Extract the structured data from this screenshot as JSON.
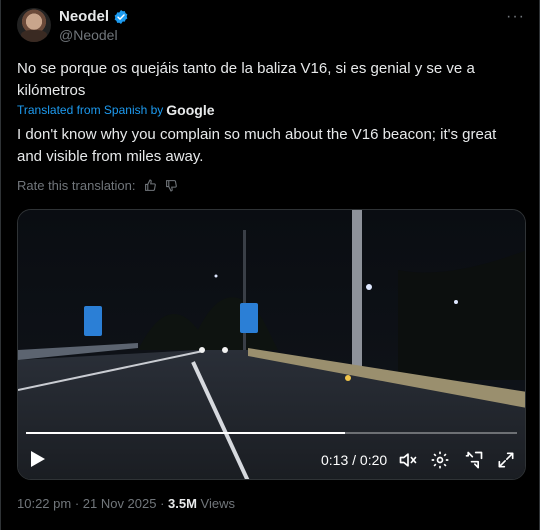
{
  "author": {
    "display_name": "Neodel",
    "handle": "@Neodel",
    "verified": true
  },
  "more_icon": "more-horizontal-icon",
  "tweet": {
    "text": "No se porque os quejáis tanto de la baliza V16, si es genial y se ve a kilómetros",
    "translated_prefix": "Translated from Spanish by",
    "translated_provider": "Google",
    "translation": "I don't know why you complain so much about the V16 beacon; it's great and visible from miles away.",
    "rate_label": "Rate this translation:"
  },
  "video": {
    "time_label": "0:13 / 0:20",
    "progress": 0.65,
    "accent": "#1d9bf0"
  },
  "meta": {
    "timestamp": "10:22 pm · 21 Nov 2025 · ",
    "views_count": "3.5M",
    "views_label": " Views"
  }
}
